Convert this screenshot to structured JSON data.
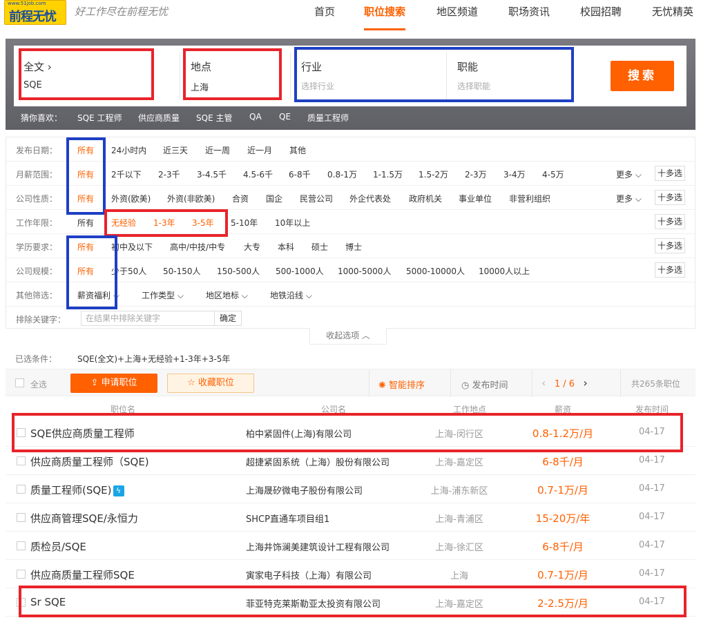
{
  "logo": {
    "top": "www.51job.com",
    "main": "前程无忧"
  },
  "slogan": "好工作尽在前程无忧",
  "nav": [
    "首页",
    "职位搜索",
    "地区频道",
    "职场资讯",
    "校园招聘",
    "无忧精英"
  ],
  "search": {
    "fulltext_label": "全文",
    "fulltext_value": "SQE",
    "location_label": "地点",
    "location_value": "上海",
    "industry_label": "行业",
    "industry_placeholder": "选择行业",
    "function_label": "职能",
    "function_placeholder": "选择职能",
    "button": "搜索"
  },
  "guess": {
    "label": "猜你喜欢：",
    "items": [
      "SQE 工程师",
      "供应商质量",
      "SQE 主管",
      "QA",
      "QE",
      "质量工程师"
    ]
  },
  "filters": {
    "date": {
      "label": "发布日期：",
      "options": [
        "所有",
        "24小时内",
        "近三天",
        "近一周",
        "近一月",
        "其他"
      ]
    },
    "salary": {
      "label": "月薪范围：",
      "options": [
        "所有",
        "2千以下",
        "2-3千",
        "3-4.5千",
        "4.5-6千",
        "6-8千",
        "0.8-1万",
        "1-1.5万",
        "1.5-2万",
        "2-3万",
        "3-4万",
        "4-5万"
      ]
    },
    "company_type": {
      "label": "公司性质：",
      "options": [
        "所有",
        "外资(欧美)",
        "外资(非欧美)",
        "合资",
        "国企",
        "民营公司",
        "外企代表处",
        "政府机关",
        "事业单位",
        "非营利组织"
      ]
    },
    "experience": {
      "label": "工作年限：",
      "options": [
        "所有",
        "无经验",
        "1-3年",
        "3-5年",
        "5-10年",
        "10年以上"
      ]
    },
    "education": {
      "label": "学历要求：",
      "options": [
        "所有",
        "初中及以下",
        "高中/中技/中专",
        "大专",
        "本科",
        "硕士",
        "博士"
      ]
    },
    "size": {
      "label": "公司规模：",
      "options": [
        "所有",
        "少于50人",
        "50-150人",
        "150-500人",
        "500-1000人",
        "1000-5000人",
        "5000-10000人",
        "10000人以上"
      ]
    },
    "other": {
      "label": "其他筛选：",
      "options": [
        "薪资福利",
        "工作类型",
        "地区地标",
        "地铁沿线"
      ]
    },
    "exclude": {
      "label": "排除关键字：",
      "placeholder": "在结果中排除关键字",
      "button": "确定"
    },
    "more": "更多",
    "multi": "十多选"
  },
  "collapse": "收起选项",
  "selected": {
    "label": "已选条件：",
    "value": "SQE(全文)+上海+无经验+1-3年+3-5年"
  },
  "toolbar": {
    "select_all": "全选",
    "apply": "申请职位",
    "favorite": "收藏职位",
    "smart_sort": "智能排序",
    "pub_time": "发布时间",
    "page": "1 / 6",
    "total": "共265条职位"
  },
  "columns": [
    "职位名",
    "公司名",
    "工作地点",
    "薪资",
    "发布时间"
  ],
  "jobs": [
    {
      "title": "SQE供应商质量工程师",
      "company": "柏中紧固件(上海)有限公司",
      "location": "上海-闵行区",
      "salary": "0.8-1.2万/月",
      "date": "04-17"
    },
    {
      "title": "供应商质量工程师（SQE)",
      "company": "超捷紧固系统（上海）股份有限公司",
      "location": "上海-嘉定区",
      "salary": "6-8千/月",
      "date": "04-17"
    },
    {
      "title": "质量工程师(SQE)",
      "company": "上海晟矽微电子股份有限公司",
      "location": "上海-浦东新区",
      "salary": "0.7-1万/月",
      "date": "04-17"
    },
    {
      "title": "供应商管理SQE/永恒力",
      "company": "SHCP直通车项目组1",
      "location": "上海-青浦区",
      "salary": "15-20万/年",
      "date": "04-17"
    },
    {
      "title": "质检员/SQE",
      "company": "上海井饰澜美建筑设计工程有限公司",
      "location": "上海-徐汇区",
      "salary": "6-8千/月",
      "date": "04-17"
    },
    {
      "title": "供应商质量工程师SQE",
      "company": "寅家电子科技（上海）有限公司",
      "location": "上海",
      "salary": "0.7-1万/月",
      "date": "04-17"
    },
    {
      "title": "Sr SQE",
      "company": "菲亚特克莱斯勒亚太投资有限公司",
      "location": "上海-嘉定区",
      "salary": "2-2.5万/月",
      "date": "04-17"
    }
  ],
  "colors": {
    "accent": "#ff6000",
    "annotation_red": "#e8232b",
    "annotation_blue": "#1e3fc4"
  }
}
